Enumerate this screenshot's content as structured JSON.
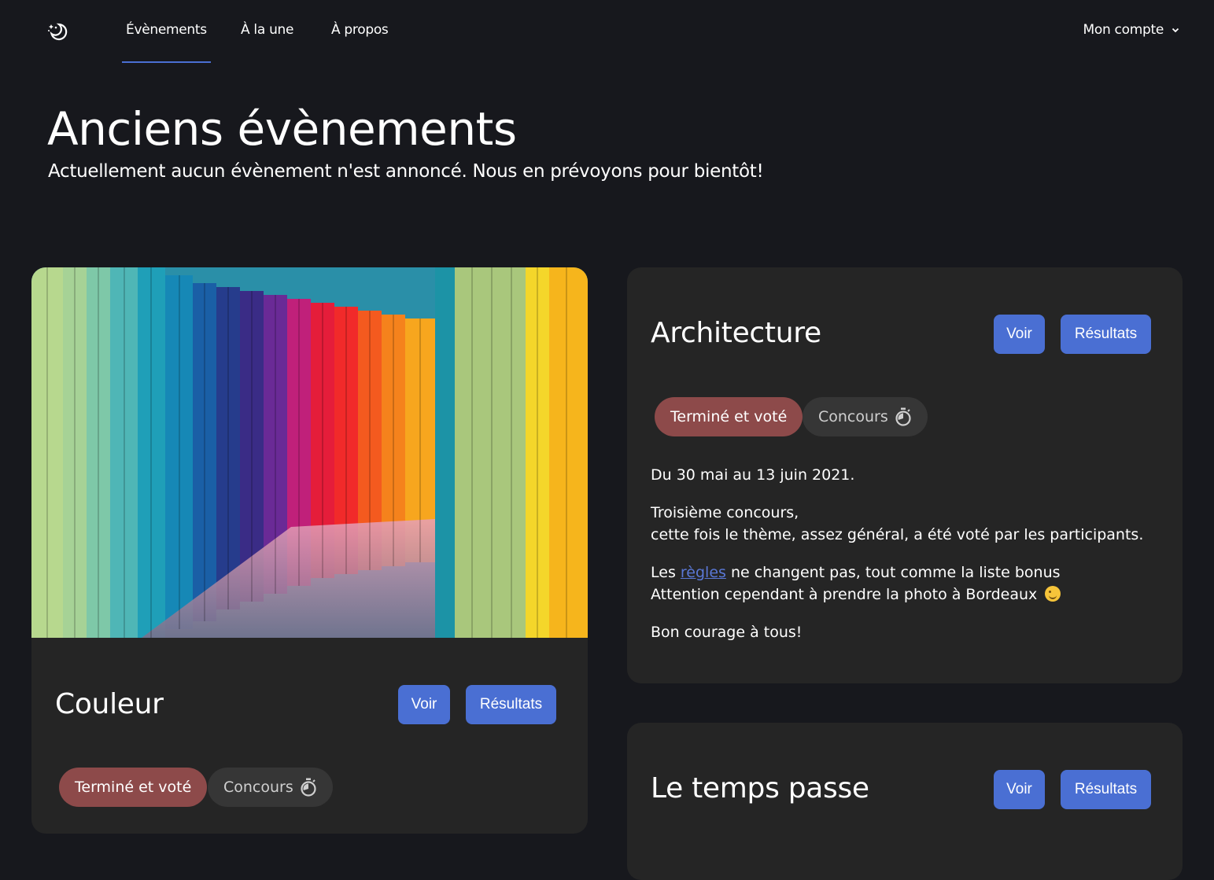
{
  "nav": {
    "logo_icon": "moon-stars-icon",
    "links": [
      {
        "label": "Évènements",
        "active": true
      },
      {
        "label": "À la une",
        "active": false
      },
      {
        "label": "À propos",
        "active": false
      }
    ],
    "account_label": "Mon compte",
    "account_icon": "chevron-down-icon"
  },
  "hero": {
    "title": "Anciens évènements",
    "subtitle": "Actuellement aucun évènement n'est annoncé. Nous en prévoyons pour bientôt!"
  },
  "events": [
    {
      "title": "Couleur",
      "view_label": "Voir",
      "results_label": "Résultats",
      "status": "Terminé et voté",
      "type": "Concours",
      "type_icon": "stopwatch-icon"
    },
    {
      "title": "Architecture",
      "view_label": "Voir",
      "results_label": "Résultats",
      "status": "Terminé et voté",
      "type": "Concours",
      "type_icon": "stopwatch-icon",
      "dates": "Du 30 mai au 13 juin 2021.",
      "desc_line1": "Troisième concours,",
      "desc_line2": "cette fois le thème, assez général, a été voté par les participants.",
      "rules_prefix": "Les ",
      "rules_link": "règles",
      "rules_suffix": " ne changent pas, tout comme la liste bonus",
      "warning": "Attention cependant à prendre la photo à Bordeaux",
      "warning_icon": "wink-emoji-icon",
      "closing": "Bon courage à tous!"
    },
    {
      "title": "Le temps passe",
      "view_label": "Voir",
      "results_label": "Résultats"
    }
  ],
  "colors": {
    "background": "#17181d",
    "card": "#252525",
    "accent": "#4a6fd3",
    "status_pill": "#8d4a4a",
    "type_pill": "#363636"
  }
}
